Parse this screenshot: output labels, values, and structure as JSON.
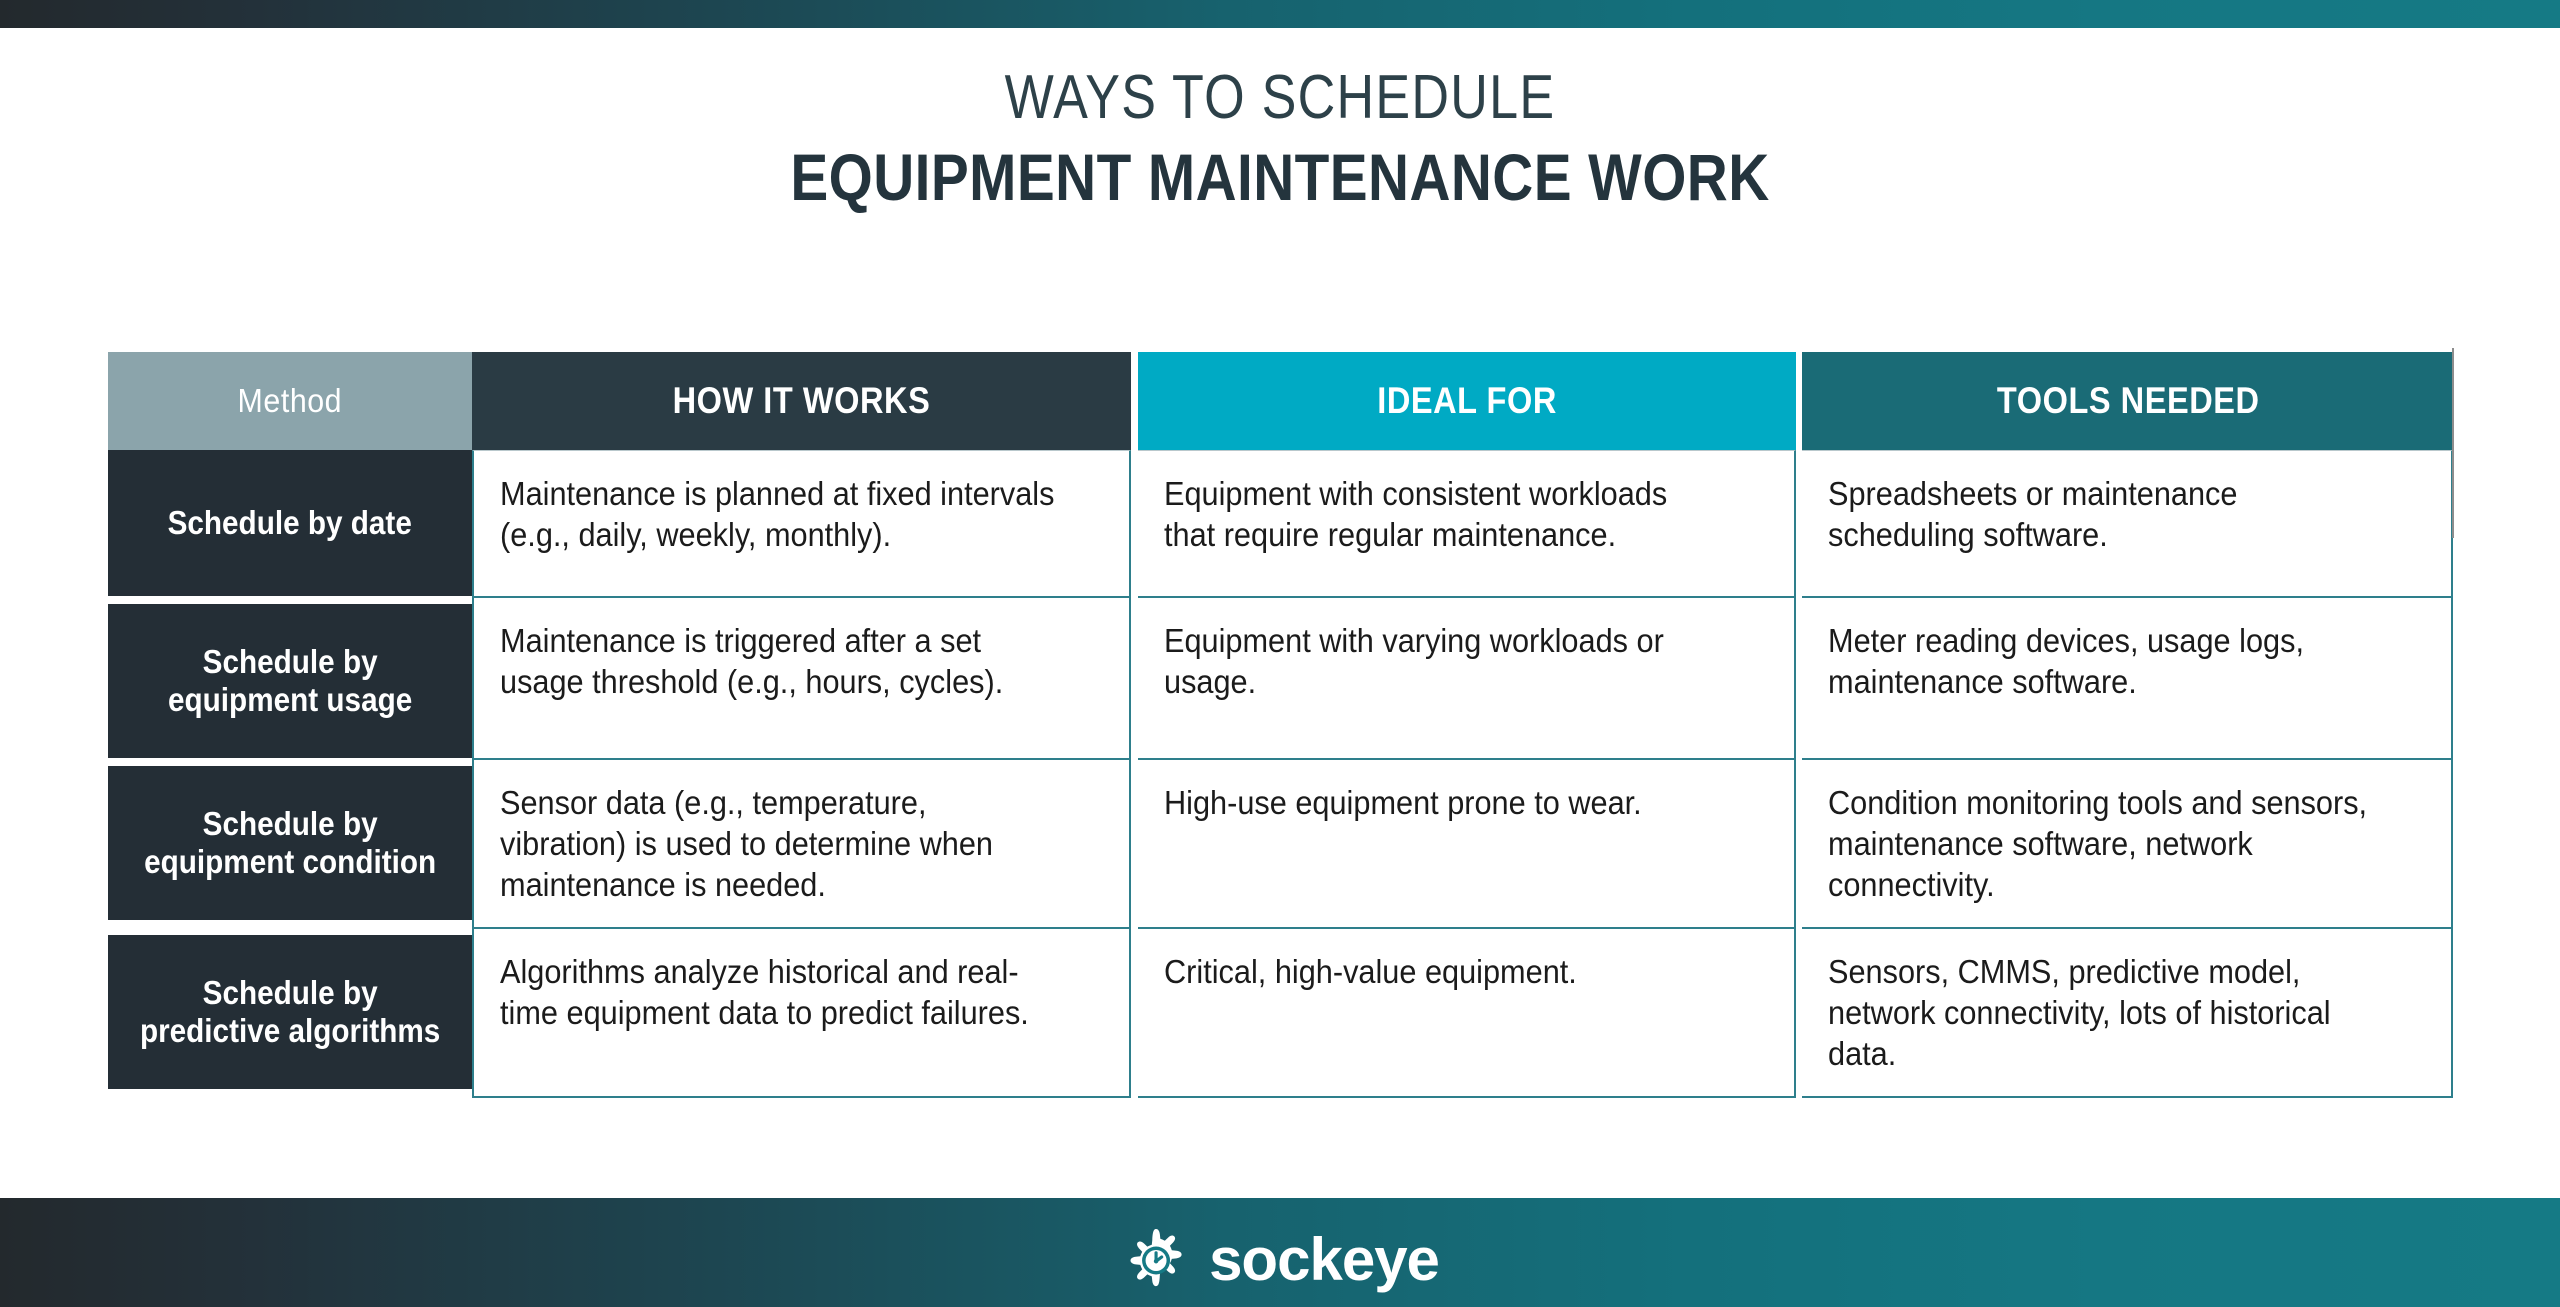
{
  "title": {
    "line1": "WAYS TO SCHEDULE",
    "line2": "EQUIPMENT MAINTENANCE WORK"
  },
  "colors": {
    "bar_gradient_start": "#23292d",
    "bar_gradient_end": "#157a85",
    "header_method_bg": "#8ba4ab",
    "header_how_bg": "#2a3b44",
    "header_ideal_bg": "#00aac4",
    "header_tools_bg": "#1a6b76",
    "method_box_bg": "#242e36",
    "grid_line": "#2e7f8c",
    "title_text": "#2d4149",
    "body_text": "#1b1b1b"
  },
  "table": {
    "headers": {
      "method": "Method",
      "how_it_works": "HOW IT WORKS",
      "ideal_for": "IDEAL FOR",
      "tools_needed": "TOOLS NEEDED"
    },
    "rows": [
      {
        "method": "Schedule by date",
        "how_it_works": "Maintenance is planned at fixed intervals (e.g., daily, weekly, monthly).",
        "ideal_for": "Equipment with consistent workloads that require regular maintenance.",
        "tools_needed": "Spreadsheets or maintenance scheduling software."
      },
      {
        "method": "Schedule by equipment usage",
        "how_it_works": "Maintenance is triggered after a set usage threshold (e.g., hours, cycles).",
        "ideal_for": "Equipment with varying workloads or usage.",
        "tools_needed": "Meter reading devices, usage logs, maintenance software."
      },
      {
        "method": "Schedule by equipment condition",
        "how_it_works": "Sensor data (e.g., temperature, vibration) is used to determine when maintenance is needed.",
        "ideal_for": "High-use equipment prone to wear.",
        "tools_needed": "Condition monitoring tools and sensors, maintenance software, network connectivity."
      },
      {
        "method": "Schedule by predictive algorithms",
        "how_it_works": "Algorithms analyze historical and real-time equipment data to predict failures.",
        "ideal_for": "Critical, high-value equipment.",
        "tools_needed": "Sensors, CMMS, predictive model, network connectivity, lots of historical data."
      }
    ]
  },
  "footer": {
    "brand": "sockeye",
    "logo_icon": "gear-eye-icon"
  }
}
